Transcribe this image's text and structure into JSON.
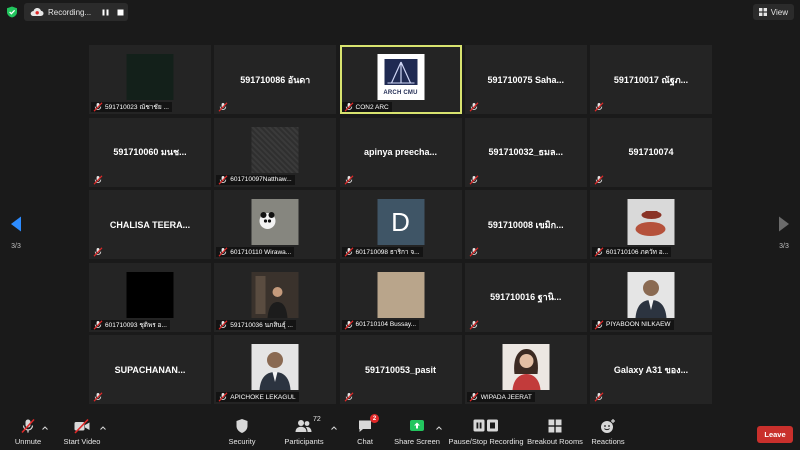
{
  "topbar": {
    "recording_label": "Recording...",
    "view_label": "View"
  },
  "grid": {
    "tiles": [
      {
        "name": "591710023 ณัชาชัย ...",
        "kind": "caption",
        "photo": "ph-dark-green"
      },
      {
        "name": "591710086 อันดา",
        "kind": "center"
      },
      {
        "name": "CON2 ARC",
        "kind": "caption",
        "photo": "ph-logo",
        "active": true
      },
      {
        "name": "591710075 Saha...",
        "kind": "center"
      },
      {
        "name": "591710017 ณัฐภ...",
        "kind": "center"
      },
      {
        "name": "591710060 มนช...",
        "kind": "center"
      },
      {
        "name": "601710097Natthaw...",
        "kind": "caption",
        "photo": "ph-noise"
      },
      {
        "name": "apinya  preecha...",
        "kind": "center"
      },
      {
        "name": "591710032_ธมล...",
        "kind": "center"
      },
      {
        "name": "591710074",
        "kind": "center"
      },
      {
        "name": "CHALISA  TEERA...",
        "kind": "center"
      },
      {
        "name": "601710110 Wirawa...",
        "kind": "caption",
        "photo": "ph-panda"
      },
      {
        "name": "601710098 ธาริกา จ...",
        "kind": "caption",
        "photo": "ph-d",
        "initial": "D"
      },
      {
        "name": "591710008 เขมิก...",
        "kind": "center"
      },
      {
        "name": "601710106 ภควัท อ...",
        "kind": "caption",
        "photo": "ph-cow"
      },
      {
        "name": "601710093 ชุติพร อ...",
        "kind": "caption",
        "photo": "ph-black"
      },
      {
        "name": "591710036 นภสินธุ์ ...",
        "kind": "caption",
        "photo": "ph-office"
      },
      {
        "name": "601710104 Bussay...",
        "kind": "caption",
        "photo": "ph-beige"
      },
      {
        "name": "591710016 ฐานิ...",
        "kind": "center"
      },
      {
        "name": "PIYABOON NILKAEW",
        "kind": "caption",
        "photo": "ph-suit"
      },
      {
        "name": "SUPACHANAN...",
        "kind": "center"
      },
      {
        "name": "APICHOKE LEKAGUL",
        "kind": "caption",
        "photo": "ph-suit"
      },
      {
        "name": "591710053_pasit",
        "kind": "center"
      },
      {
        "name": "WIPADA JEERAT",
        "kind": "caption",
        "photo": "ph-woman"
      },
      {
        "name": "Galaxy A31 ของ...",
        "kind": "center"
      }
    ],
    "logo_text": "ARCH CMU"
  },
  "nav": {
    "left_page": "3/3",
    "right_page": "3/3"
  },
  "toolbar": {
    "unmute": "Unmute",
    "start_video": "Start Video",
    "security": "Security",
    "participants": "Participants",
    "participants_count": "72",
    "chat": "Chat",
    "chat_badge": "2",
    "share_screen": "Share Screen",
    "pause_recording": "Pause/Stop Recording",
    "breakout_rooms": "Breakout Rooms",
    "reactions": "Reactions",
    "leave": "Leave"
  },
  "colors": {
    "active_speaker": "#d8e36f",
    "share_green": "#22c55e",
    "leave_red": "#c9302c",
    "nav_blue": "#2d8cff"
  }
}
